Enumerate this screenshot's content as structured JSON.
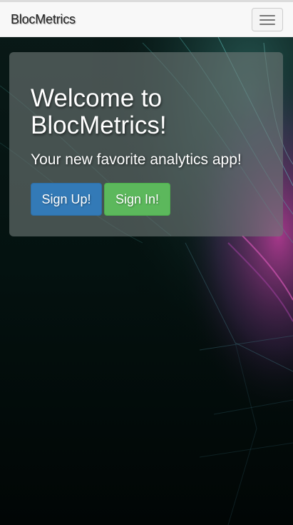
{
  "navbar": {
    "brand": "BlocMetrics",
    "toggle_icon": "hamburger-menu-icon"
  },
  "hero": {
    "headline": "Welcome to BlocMetrics!",
    "subheadline": "Your new favorite analytics app!",
    "signup_label": "Sign Up!",
    "signin_label": "Sign In!"
  },
  "colors": {
    "navbar_bg": "#f8f8f8",
    "signup_button": "#337ab7",
    "signin_button": "#5cb85c",
    "page_bg": "#020807"
  }
}
